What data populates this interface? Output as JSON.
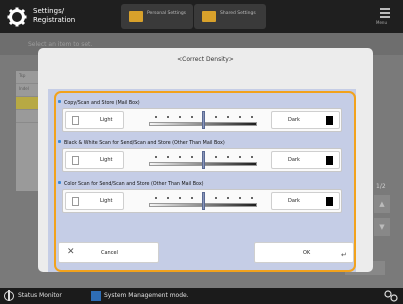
{
  "app": {
    "title": "Settings/ Registration"
  },
  "topbar": {
    "buttons": [
      {
        "label": "Personal Settings"
      },
      {
        "label": "Shared Settings"
      }
    ],
    "menu_label": "Menu"
  },
  "background": {
    "header_text": "Select an item to set.",
    "list_rows": [
      "Tsp",
      "Indel",
      "",
      ""
    ],
    "page_indicator": "1/2"
  },
  "dialog": {
    "title": "<Correct Density>",
    "settings": [
      {
        "label": "Copy/Scan and Store (Mail Box)",
        "light_label": "Light",
        "dark_label": "Dark",
        "level": 0
      },
      {
        "label": "Black & White Scan for Send/Scan and Store (Other Than Mail Box)",
        "light_label": "Light",
        "dark_label": "Dark",
        "level": 0
      },
      {
        "label": "Color Scan for Send/Scan and Store (Other Than Mail Box)",
        "light_label": "Light",
        "dark_label": "Dark",
        "level": 0
      }
    ],
    "cancel_label": "Cancel",
    "ok_label": "OK"
  },
  "statusbar": {
    "status_monitor_label": "Status Monitor",
    "mode_label": "System Management mode."
  },
  "colors": {
    "highlight_border": "#f2a21c",
    "panel_bg": "#c5cde6",
    "accent_blue": "#3e88d6"
  }
}
